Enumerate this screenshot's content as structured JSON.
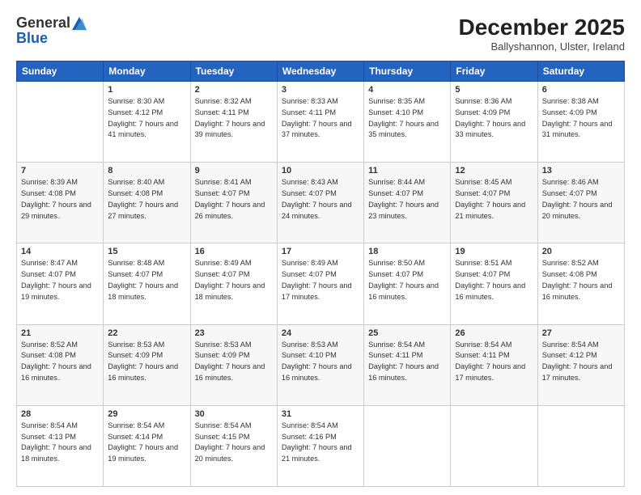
{
  "logo": {
    "general": "General",
    "blue": "Blue"
  },
  "header": {
    "title": "December 2025",
    "location": "Ballyshannon, Ulster, Ireland"
  },
  "days_of_week": [
    "Sunday",
    "Monday",
    "Tuesday",
    "Wednesday",
    "Thursday",
    "Friday",
    "Saturday"
  ],
  "weeks": [
    [
      {
        "day": "",
        "sunrise": "",
        "sunset": "",
        "daylight": ""
      },
      {
        "day": "1",
        "sunrise": "Sunrise: 8:30 AM",
        "sunset": "Sunset: 4:12 PM",
        "daylight": "Daylight: 7 hours and 41 minutes."
      },
      {
        "day": "2",
        "sunrise": "Sunrise: 8:32 AM",
        "sunset": "Sunset: 4:11 PM",
        "daylight": "Daylight: 7 hours and 39 minutes."
      },
      {
        "day": "3",
        "sunrise": "Sunrise: 8:33 AM",
        "sunset": "Sunset: 4:11 PM",
        "daylight": "Daylight: 7 hours and 37 minutes."
      },
      {
        "day": "4",
        "sunrise": "Sunrise: 8:35 AM",
        "sunset": "Sunset: 4:10 PM",
        "daylight": "Daylight: 7 hours and 35 minutes."
      },
      {
        "day": "5",
        "sunrise": "Sunrise: 8:36 AM",
        "sunset": "Sunset: 4:09 PM",
        "daylight": "Daylight: 7 hours and 33 minutes."
      },
      {
        "day": "6",
        "sunrise": "Sunrise: 8:38 AM",
        "sunset": "Sunset: 4:09 PM",
        "daylight": "Daylight: 7 hours and 31 minutes."
      }
    ],
    [
      {
        "day": "7",
        "sunrise": "Sunrise: 8:39 AM",
        "sunset": "Sunset: 4:08 PM",
        "daylight": "Daylight: 7 hours and 29 minutes."
      },
      {
        "day": "8",
        "sunrise": "Sunrise: 8:40 AM",
        "sunset": "Sunset: 4:08 PM",
        "daylight": "Daylight: 7 hours and 27 minutes."
      },
      {
        "day": "9",
        "sunrise": "Sunrise: 8:41 AM",
        "sunset": "Sunset: 4:07 PM",
        "daylight": "Daylight: 7 hours and 26 minutes."
      },
      {
        "day": "10",
        "sunrise": "Sunrise: 8:43 AM",
        "sunset": "Sunset: 4:07 PM",
        "daylight": "Daylight: 7 hours and 24 minutes."
      },
      {
        "day": "11",
        "sunrise": "Sunrise: 8:44 AM",
        "sunset": "Sunset: 4:07 PM",
        "daylight": "Daylight: 7 hours and 23 minutes."
      },
      {
        "day": "12",
        "sunrise": "Sunrise: 8:45 AM",
        "sunset": "Sunset: 4:07 PM",
        "daylight": "Daylight: 7 hours and 21 minutes."
      },
      {
        "day": "13",
        "sunrise": "Sunrise: 8:46 AM",
        "sunset": "Sunset: 4:07 PM",
        "daylight": "Daylight: 7 hours and 20 minutes."
      }
    ],
    [
      {
        "day": "14",
        "sunrise": "Sunrise: 8:47 AM",
        "sunset": "Sunset: 4:07 PM",
        "daylight": "Daylight: 7 hours and 19 minutes."
      },
      {
        "day": "15",
        "sunrise": "Sunrise: 8:48 AM",
        "sunset": "Sunset: 4:07 PM",
        "daylight": "Daylight: 7 hours and 18 minutes."
      },
      {
        "day": "16",
        "sunrise": "Sunrise: 8:49 AM",
        "sunset": "Sunset: 4:07 PM",
        "daylight": "Daylight: 7 hours and 18 minutes."
      },
      {
        "day": "17",
        "sunrise": "Sunrise: 8:49 AM",
        "sunset": "Sunset: 4:07 PM",
        "daylight": "Daylight: 7 hours and 17 minutes."
      },
      {
        "day": "18",
        "sunrise": "Sunrise: 8:50 AM",
        "sunset": "Sunset: 4:07 PM",
        "daylight": "Daylight: 7 hours and 16 minutes."
      },
      {
        "day": "19",
        "sunrise": "Sunrise: 8:51 AM",
        "sunset": "Sunset: 4:07 PM",
        "daylight": "Daylight: 7 hours and 16 minutes."
      },
      {
        "day": "20",
        "sunrise": "Sunrise: 8:52 AM",
        "sunset": "Sunset: 4:08 PM",
        "daylight": "Daylight: 7 hours and 16 minutes."
      }
    ],
    [
      {
        "day": "21",
        "sunrise": "Sunrise: 8:52 AM",
        "sunset": "Sunset: 4:08 PM",
        "daylight": "Daylight: 7 hours and 16 minutes."
      },
      {
        "day": "22",
        "sunrise": "Sunrise: 8:53 AM",
        "sunset": "Sunset: 4:09 PM",
        "daylight": "Daylight: 7 hours and 16 minutes."
      },
      {
        "day": "23",
        "sunrise": "Sunrise: 8:53 AM",
        "sunset": "Sunset: 4:09 PM",
        "daylight": "Daylight: 7 hours and 16 minutes."
      },
      {
        "day": "24",
        "sunrise": "Sunrise: 8:53 AM",
        "sunset": "Sunset: 4:10 PM",
        "daylight": "Daylight: 7 hours and 16 minutes."
      },
      {
        "day": "25",
        "sunrise": "Sunrise: 8:54 AM",
        "sunset": "Sunset: 4:11 PM",
        "daylight": "Daylight: 7 hours and 16 minutes."
      },
      {
        "day": "26",
        "sunrise": "Sunrise: 8:54 AM",
        "sunset": "Sunset: 4:11 PM",
        "daylight": "Daylight: 7 hours and 17 minutes."
      },
      {
        "day": "27",
        "sunrise": "Sunrise: 8:54 AM",
        "sunset": "Sunset: 4:12 PM",
        "daylight": "Daylight: 7 hours and 17 minutes."
      }
    ],
    [
      {
        "day": "28",
        "sunrise": "Sunrise: 8:54 AM",
        "sunset": "Sunset: 4:13 PM",
        "daylight": "Daylight: 7 hours and 18 minutes."
      },
      {
        "day": "29",
        "sunrise": "Sunrise: 8:54 AM",
        "sunset": "Sunset: 4:14 PM",
        "daylight": "Daylight: 7 hours and 19 minutes."
      },
      {
        "day": "30",
        "sunrise": "Sunrise: 8:54 AM",
        "sunset": "Sunset: 4:15 PM",
        "daylight": "Daylight: 7 hours and 20 minutes."
      },
      {
        "day": "31",
        "sunrise": "Sunrise: 8:54 AM",
        "sunset": "Sunset: 4:16 PM",
        "daylight": "Daylight: 7 hours and 21 minutes."
      },
      {
        "day": "",
        "sunrise": "",
        "sunset": "",
        "daylight": ""
      },
      {
        "day": "",
        "sunrise": "",
        "sunset": "",
        "daylight": ""
      },
      {
        "day": "",
        "sunrise": "",
        "sunset": "",
        "daylight": ""
      }
    ]
  ]
}
